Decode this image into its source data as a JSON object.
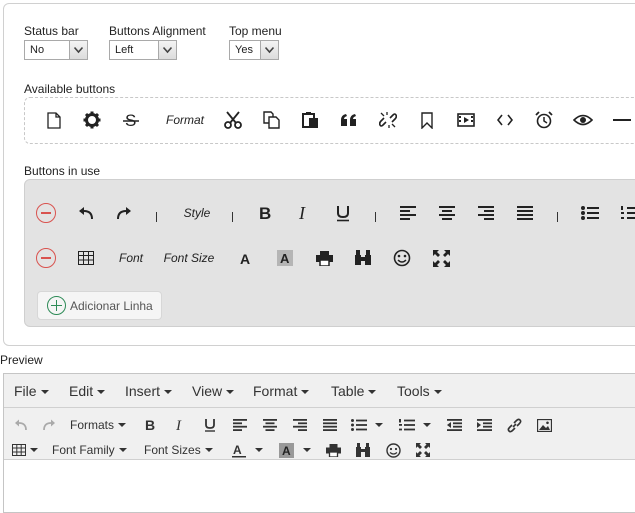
{
  "settings": {
    "status_bar": {
      "label": "Status bar",
      "value": "No"
    },
    "buttons_alignment": {
      "label": "Buttons Alignment",
      "value": "Left"
    },
    "top_menu": {
      "label": "Top menu",
      "value": "Yes"
    }
  },
  "available": {
    "label": "Available buttons",
    "items": [
      "new-document-icon",
      "gear-icon",
      "strikethrough-icon",
      "Format",
      "cut-icon",
      "copy-icon",
      "paste-icon",
      "blockquote-icon",
      "unlink-icon",
      "bookmark-icon",
      "media-icon",
      "code-icon",
      "alarm-icon",
      "preview-icon",
      "horizontal-rule-icon"
    ]
  },
  "in_use": {
    "label": "Buttons in use",
    "row1": [
      "undo-icon",
      "redo-icon",
      "Style",
      "bold-icon",
      "italic-icon",
      "underline-icon",
      "align-left-icon",
      "align-center-icon",
      "align-right-icon",
      "align-justify-icon",
      "bullet-list-icon",
      "numbered-list-icon"
    ],
    "row2": [
      "table-icon",
      "Font",
      "Font Size",
      "text-color-icon",
      "background-color-icon",
      "print-icon",
      "find-icon",
      "emoticon-icon",
      "fullscreen-icon"
    ],
    "add_line": "Adicionar Linha"
  },
  "preview": {
    "label": "Preview",
    "menu": [
      "File",
      "Edit",
      "Insert",
      "View",
      "Format",
      "Table",
      "Tools"
    ],
    "toolbar_row1": {
      "formats": "Formats"
    },
    "toolbar_row2": {
      "font_family": "Font Family",
      "font_sizes": "Font Sizes"
    }
  }
}
